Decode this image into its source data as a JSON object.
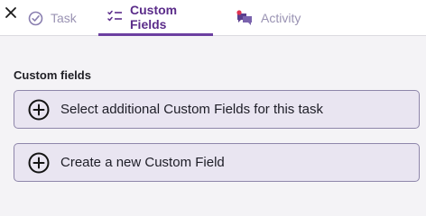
{
  "header": {
    "tabs": [
      {
        "label": "Task",
        "icon": "check-circle-icon",
        "active": false
      },
      {
        "label": "Custom Fields",
        "icon": "checklist-icon",
        "active": true
      },
      {
        "label": "Activity",
        "icon": "chat-bubbles-icon",
        "active": false,
        "notification": true
      }
    ]
  },
  "main": {
    "section_title": "Custom fields",
    "buttons": [
      {
        "label": "Select additional Custom Fields for this task",
        "icon": "plus-circle-icon"
      },
      {
        "label": "Create a new Custom Field",
        "icon": "plus-circle-icon"
      }
    ]
  },
  "colors": {
    "accent": "#6b3fa0",
    "inactive_tab": "#9a93b3",
    "button_bg": "#e9e5f1",
    "button_border": "#8e86aa",
    "notification_dot": "#e0324f"
  }
}
